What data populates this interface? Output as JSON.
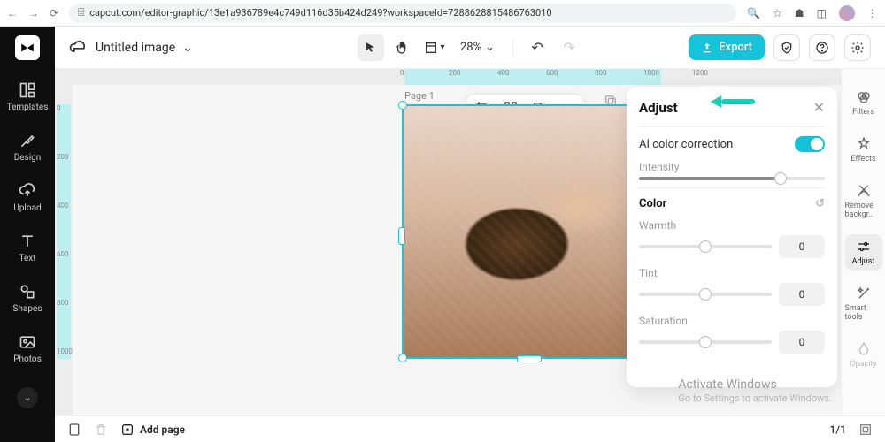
{
  "browser": {
    "url": "capcut.com/editor-graphic/13e1a936789e4c749d116d35b424d249?workspaceId=7288628815486763010"
  },
  "document": {
    "title": "Untitled image"
  },
  "toolbar": {
    "zoom": "28%",
    "export_label": "Export"
  },
  "left_rail": [
    {
      "label": "Templates"
    },
    {
      "label": "Design"
    },
    {
      "label": "Upload"
    },
    {
      "label": "Text"
    },
    {
      "label": "Shapes"
    },
    {
      "label": "Photos"
    }
  ],
  "ruler_ticks": [
    "0",
    "200",
    "400",
    "600",
    "800",
    "1000",
    "1200"
  ],
  "vruler_ticks": [
    "0",
    "200",
    "400",
    "600",
    "800",
    "1000"
  ],
  "canvas": {
    "page_label": "Page 1"
  },
  "adjust_panel": {
    "title": "Adjust",
    "ai_label": "AI color correction",
    "ai_on": true,
    "intensity_label": "Intensity",
    "intensity_pct": 76,
    "color_section": "Color",
    "sliders": [
      {
        "label": "Warmth",
        "value": "0",
        "pct": 50
      },
      {
        "label": "Tint",
        "value": "0",
        "pct": 50
      },
      {
        "label": "Saturation",
        "value": "0",
        "pct": 50
      }
    ]
  },
  "tool_strip": [
    {
      "label": "Filters",
      "selected": false
    },
    {
      "label": "Effects",
      "selected": false
    },
    {
      "label": "Remove backgr..",
      "selected": false
    },
    {
      "label": "Adjust",
      "selected": true
    },
    {
      "label": "Smart tools",
      "selected": false
    },
    {
      "label": "Opacity",
      "selected": false,
      "dim": true
    }
  ],
  "bottombar": {
    "add_page": "Add page",
    "page_indicator": "1/1"
  },
  "watermark": {
    "title": "Activate Windows",
    "sub": "Go to Settings to activate Windows."
  }
}
